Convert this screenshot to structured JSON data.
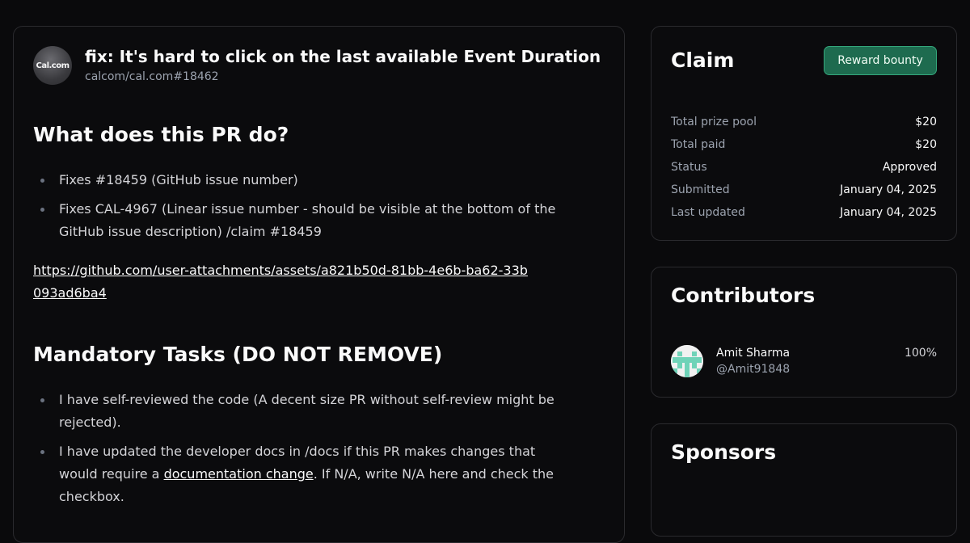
{
  "pr": {
    "logo_text": "Cal.com",
    "title": "fix: It's hard to click on the last available Event Duration",
    "ref": "calcom/cal.com#18462"
  },
  "body": {
    "heading_what": "What does this PR do?",
    "what_items": [
      "Fixes #18459 (GitHub issue number)",
      "Fixes CAL-4967 (Linear issue number - should be visible at the bottom of the GitHub issue description) /claim #18459"
    ],
    "attachment_url": "https://github.com/user-attachments/assets/a821b50d-81bb-4e6b-ba62-33b093ad6ba4",
    "heading_tasks": "Mandatory Tasks (DO NOT REMOVE)",
    "task_1": "I have self-reviewed the code (A decent size PR without self-review might be rejected).",
    "task_2_before": "I have updated the developer docs in /docs if this PR makes changes that would require a ",
    "task_2_link": "documentation change",
    "task_2_after": ". If N/A, write N/A here and check the checkbox."
  },
  "claim": {
    "title": "Claim",
    "reward_button": "Reward bounty",
    "stats": [
      {
        "label": "Total prize pool",
        "value": "$20"
      },
      {
        "label": "Total paid",
        "value": "$20"
      },
      {
        "label": "Status",
        "value": "Approved"
      },
      {
        "label": "Submitted",
        "value": "January 04, 2025"
      },
      {
        "label": "Last updated",
        "value": "January 04, 2025"
      }
    ]
  },
  "contributors": {
    "title": "Contributors",
    "list": [
      {
        "name": "Amit Sharma",
        "handle": "@Amit91848",
        "share": "100%"
      }
    ]
  },
  "sponsors": {
    "title": "Sponsors"
  },
  "colors": {
    "background": "#0a0a0c",
    "card_border": "#2a2a2e",
    "accent_button": "#1e6b4f",
    "accent_border": "#34a77b",
    "avatar_identicon": "#6fd3b8"
  }
}
